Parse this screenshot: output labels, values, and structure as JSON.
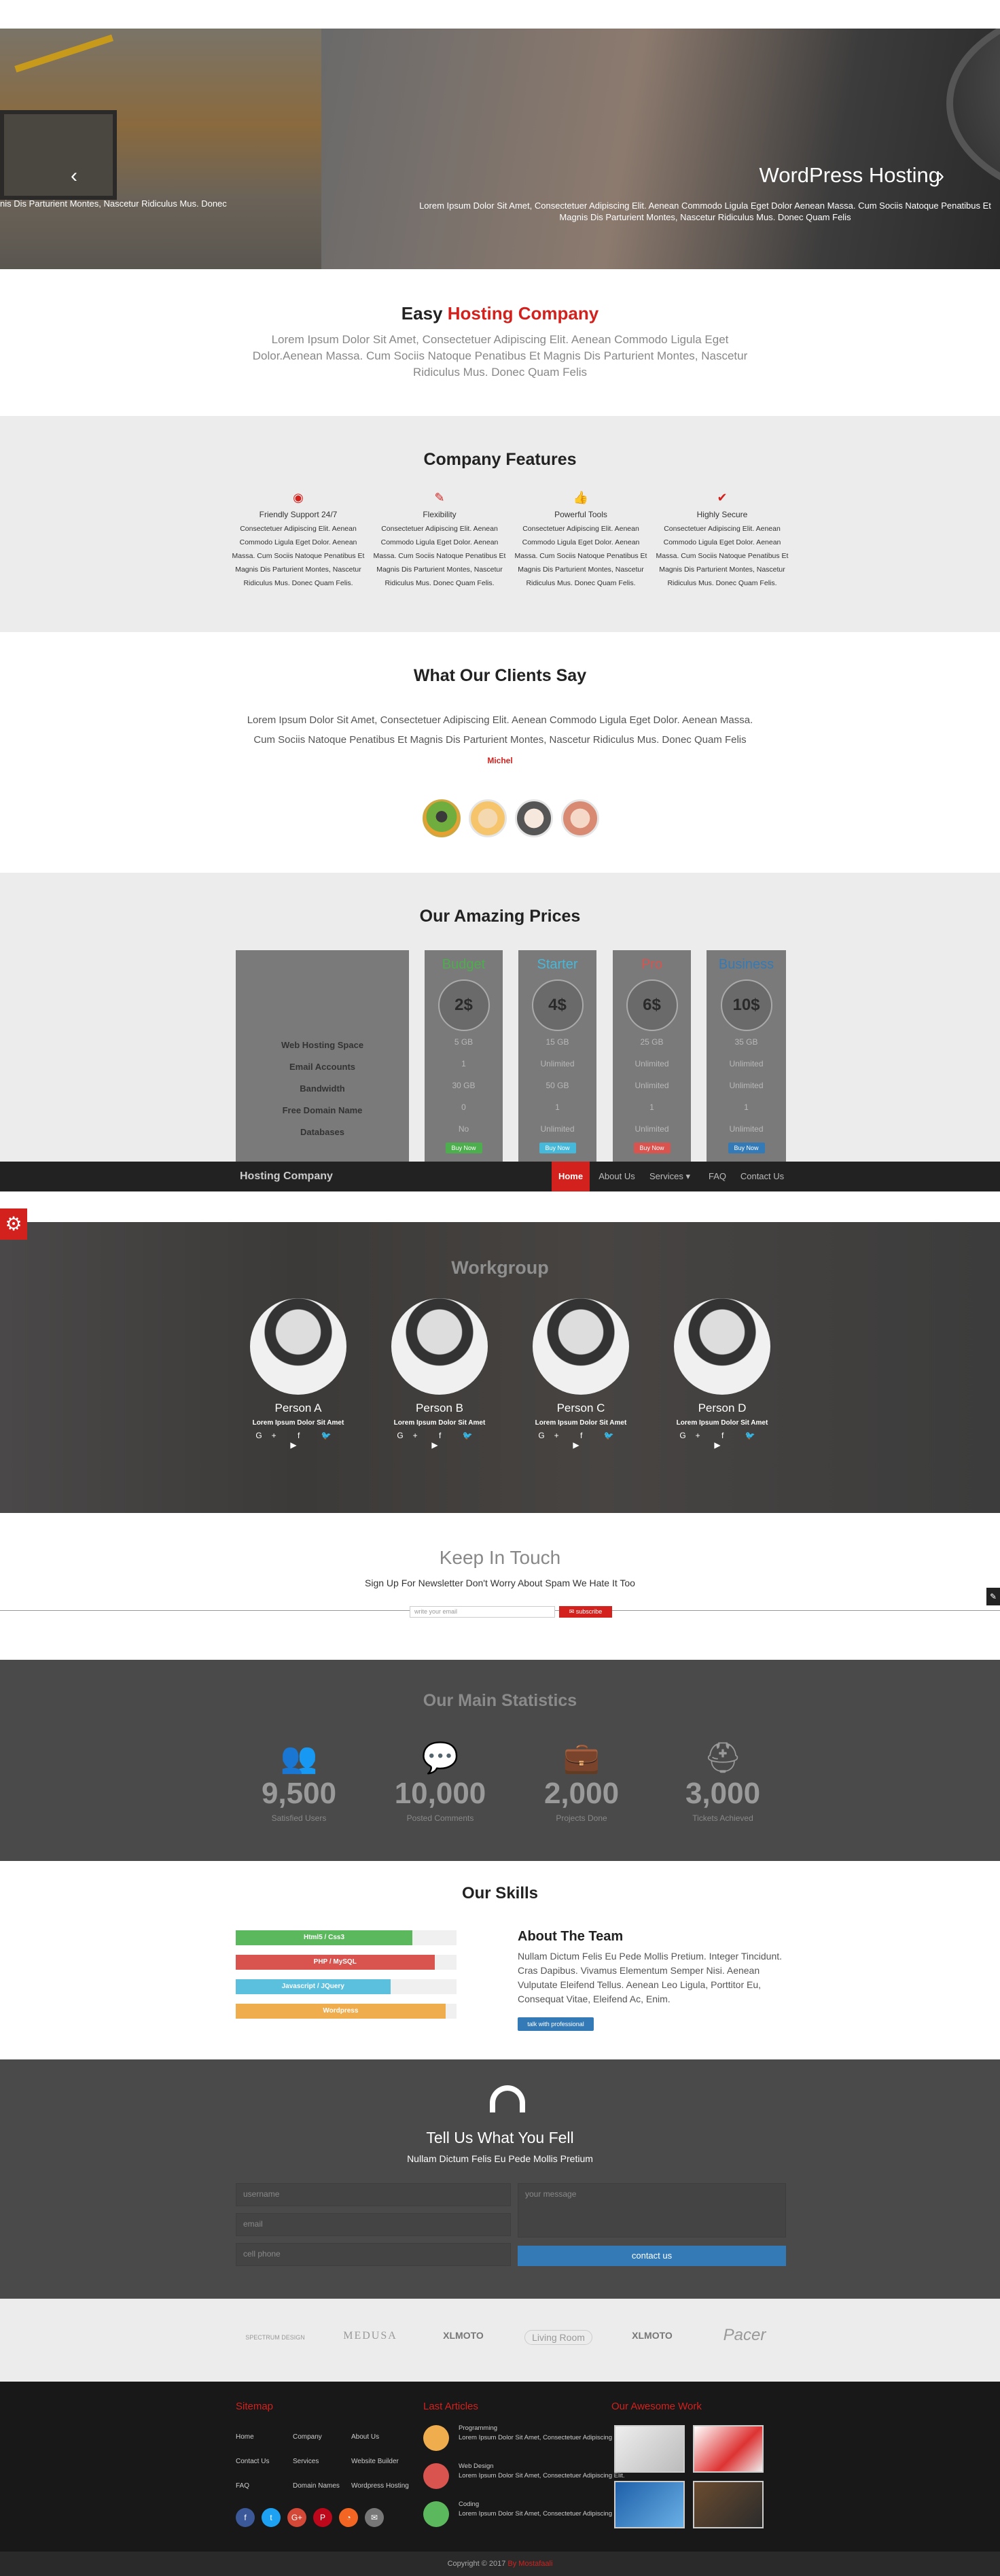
{
  "slider": {
    "title": "WordPress Hosting",
    "text": "Lorem Ipsum Dolor Sit Amet, Consectetuer Adipiscing Elit. Aenean Commodo Ligula Eget Dolor Aenean Massa. Cum Sociis Natoque Penatibus Et Magnis Dis Parturient Montes, Nascetur Ridiculus Mus. Donec Quam Felis",
    "text_left": "nis Dis Parturient Montes, Nascetur Ridiculus Mus. Donec",
    "prev": "‹",
    "next": "›"
  },
  "easy": {
    "title_plain": "Easy",
    "title_accent": "Hosting Company",
    "text": "Lorem Ipsum Dolor Sit Amet, Consectetuer Adipiscing Elit. Aenean Commodo Ligula Eget Dolor.Aenean Massa. Cum Sociis Natoque Penatibus Et Magnis Dis Parturient Montes, Nascetur Ridiculus Mus. Donec Quam Felis"
  },
  "features": {
    "title": "Company Features",
    "items": [
      {
        "icon": "eye-icon",
        "glyph": "◉",
        "title": "Friendly Support 24/7",
        "text": "Consectetuer Adipiscing Elit. Aenean Commodo Ligula Eget Dolor. Aenean Massa. Cum Sociis Natoque Penatibus Et Magnis Dis Parturient Montes, Nascetur Ridiculus Mus. Donec Quam Felis."
      },
      {
        "icon": "pencil-icon",
        "glyph": "✎",
        "title": "Flexibility",
        "text": "Consectetuer Adipiscing Elit. Aenean Commodo Ligula Eget Dolor. Aenean Massa. Cum Sociis Natoque Penatibus Et Magnis Dis Parturient Montes, Nascetur Ridiculus Mus. Donec Quam Felis."
      },
      {
        "icon": "thumbs-up-icon",
        "glyph": "👍",
        "title": "Powerful Tools",
        "text": "Consectetuer Adipiscing Elit. Aenean Commodo Ligula Eget Dolor. Aenean Massa. Cum Sociis Natoque Penatibus Et Magnis Dis Parturient Montes, Nascetur Ridiculus Mus. Donec Quam Felis."
      },
      {
        "icon": "check-icon",
        "glyph": "✔",
        "title": "Highly Secure",
        "text": "Consectetuer Adipiscing Elit. Aenean Commodo Ligula Eget Dolor. Aenean Massa. Cum Sociis Natoque Penatibus Et Magnis Dis Parturient Montes, Nascetur Ridiculus Mus. Donec Quam Felis."
      }
    ]
  },
  "clients": {
    "title": "What Our Clients Say",
    "quote": "Lorem Ipsum Dolor Sit Amet, Consectetuer Adipiscing Elit. Aenean Commodo Ligula Eget Dolor. Aenean Massa. Cum Sociis Natoque Penatibus Et Magnis Dis Parturient Montes, Nascetur Ridiculus Mus. Donec Quam Felis",
    "author": "Michel"
  },
  "prices": {
    "title": "Our Amazing Prices",
    "labels": [
      "Web Hosting Space",
      "Email Accounts",
      "Bandwidth",
      "Free Domain Name",
      "Databases"
    ],
    "plans": [
      {
        "name": "Budget",
        "color": "#4cae4c",
        "price": "2$",
        "values": [
          "5 GB",
          "1",
          "30 GB",
          "0",
          "No"
        ],
        "buy": "Buy Now"
      },
      {
        "name": "Starter",
        "color": "#46b8da",
        "price": "4$",
        "values": [
          "15 GB",
          "Unlimited",
          "50 GB",
          "1",
          "Unlimited"
        ],
        "buy": "Buy Now"
      },
      {
        "name": "Pro",
        "color": "#d9534f",
        "price": "6$",
        "values": [
          "25 GB",
          "Unlimited",
          "Unlimited",
          "1",
          "Unlimited"
        ],
        "buy": "Buy Now"
      },
      {
        "name": "Business",
        "color": "#337ab7",
        "price": "10$",
        "values": [
          "35 GB",
          "Unlimited",
          "Unlimited",
          "1",
          "Unlimited"
        ],
        "buy": "Buy Now"
      }
    ]
  },
  "navbar": {
    "brand": "Hosting Company",
    "items": [
      "Home",
      "About Us",
      "Services ▾",
      "FAQ",
      "Contact Us"
    ]
  },
  "workgroup": {
    "title": "Workgroup",
    "members": [
      {
        "name": "Person A",
        "text": "Lorem Ipsum Dolor Sit Amet",
        "social": "G+ f 🐦 ▶"
      },
      {
        "name": "Person B",
        "text": "Lorem Ipsum Dolor Sit Amet",
        "social": "G+ f 🐦 ▶"
      },
      {
        "name": "Person C",
        "text": "Lorem Ipsum Dolor Sit Amet",
        "social": "G+ f 🐦 ▶"
      },
      {
        "name": "Person D",
        "text": "Lorem Ipsum Dolor Sit Amet",
        "social": "G+ f 🐦 ▶"
      }
    ]
  },
  "newsletter": {
    "title": "Keep In Touch",
    "text": "Sign Up For Newsletter Don't Worry About Spam We Hate It Too",
    "placeholder": "write your email",
    "button": "✉ subscribe"
  },
  "stats": {
    "title": "Our Main Statistics",
    "items": [
      {
        "icon": "users-icon",
        "glyph": "👥",
        "num": "9,500",
        "cap": "Satisfied Users"
      },
      {
        "icon": "comments-icon",
        "glyph": "💬",
        "num": "10,000",
        "cap": "Posted Comments"
      },
      {
        "icon": "briefcase-icon",
        "glyph": "💼",
        "num": "2,000",
        "cap": "Projects Done"
      },
      {
        "icon": "lifebuoy-icon",
        "glyph": "⛑",
        "num": "3,000",
        "cap": "Tickets Achieved"
      }
    ]
  },
  "skills": {
    "title": "Our Skills",
    "bars": [
      {
        "label": "Html5 / Css3",
        "pct": 80,
        "color": "#5cb85c"
      },
      {
        "label": "PHP / MySQL",
        "pct": 90,
        "color": "#d9534f"
      },
      {
        "label": "Javascript / JQuery",
        "pct": 70,
        "color": "#5bc0de"
      },
      {
        "label": "Wordpress",
        "pct": 95,
        "color": "#f0ad4e"
      }
    ],
    "about_title": "About The Team",
    "about_text": "Nullam Dictum Felis Eu Pede Mollis Pretium. Integer Tincidunt. Cras Dapibus. Vivamus Elementum Semper Nisi. Aenean Vulputate Eleifend Tellus. Aenean Leo Ligula, Porttitor Eu, Consequat Vitae, Eleifend Ac, Enim.",
    "talk": "talk with professional"
  },
  "contact": {
    "title": "Tell Us What You Fell",
    "subtitle": "Nullam Dictum Felis Eu Pede Mollis Pretium",
    "username": "username",
    "email": "email",
    "phone": "cell phone",
    "message": "your message",
    "button": "contact us"
  },
  "logos": [
    "SPECTRUM DESIGN",
    "MEDUSA",
    "XLMOTO",
    "Living Room",
    "XLMOTO",
    "Pacer"
  ],
  "footer": {
    "sitemap_title": "Sitemap",
    "sitemap": [
      [
        "Home",
        "Company",
        "About Us"
      ],
      [
        "Contact Us",
        "Services",
        "Website Builder"
      ],
      [
        "FAQ",
        "Domain Names",
        "Wordpress Hosting"
      ]
    ],
    "articles_title": "Last Articles",
    "articles": [
      {
        "title": "Programming",
        "text": "Lorem Ipsum Dolor Sit Amet, Consectetuer Adipiscing Elit.",
        "color": "#f0ad4e"
      },
      {
        "title": "Web Design",
        "text": "Lorem Ipsum Dolor Sit Amet, Consectetuer Adipiscing Elit.",
        "color": "#d9534f"
      },
      {
        "title": "Coding",
        "text": "Lorem Ipsum Dolor Sit Amet, Consectetuer Adipiscing Elit.",
        "color": "#5cb85c"
      }
    ],
    "work_title": "Our Awesome Work",
    "social": [
      {
        "name": "facebook-icon",
        "glyph": "f",
        "color": "#3b5998"
      },
      {
        "name": "twitter-icon",
        "glyph": "t",
        "color": "#1da1f2"
      },
      {
        "name": "google-plus-icon",
        "glyph": "G+",
        "color": "#d34836"
      },
      {
        "name": "pinterest-icon",
        "glyph": "P",
        "color": "#bd081c"
      },
      {
        "name": "rss-icon",
        "glyph": "◔",
        "color": "#f26522"
      },
      {
        "name": "email-icon",
        "glyph": "✉",
        "color": "#777"
      }
    ],
    "copyright": "Copyright © 2017",
    "by": "By Mostafaali"
  }
}
